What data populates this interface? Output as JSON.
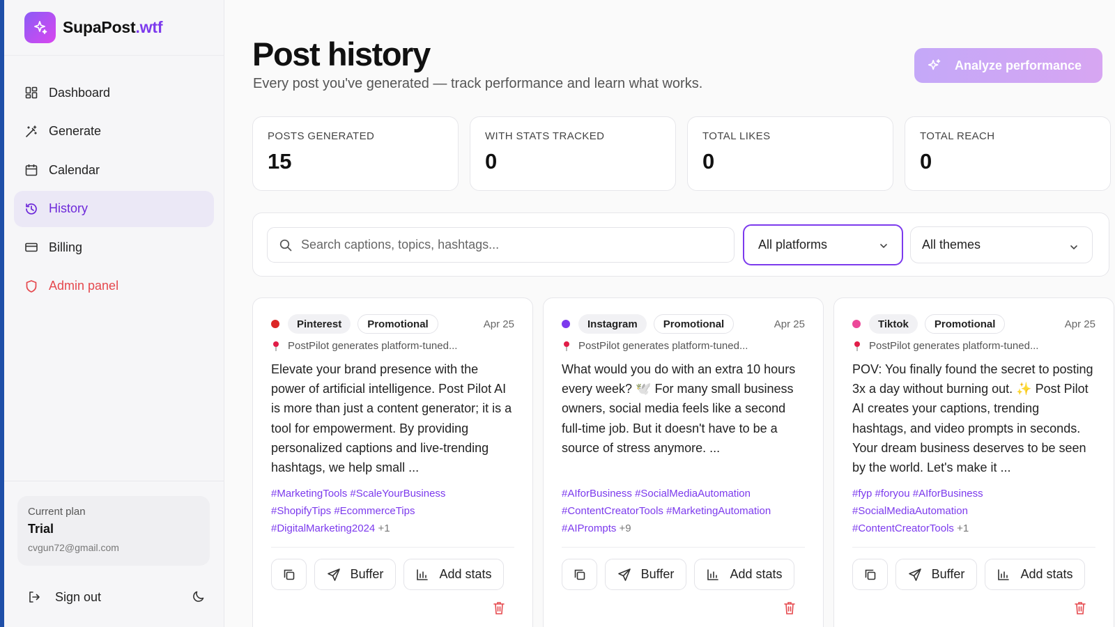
{
  "brand": {
    "name": "SupaPost",
    "tld": ".wtf"
  },
  "sidebar": {
    "items": [
      {
        "label": "Dashboard",
        "icon": "dashboard-icon"
      },
      {
        "label": "Generate",
        "icon": "wand-icon"
      },
      {
        "label": "Calendar",
        "icon": "calendar-icon"
      },
      {
        "label": "History",
        "icon": "history-icon",
        "active": true
      },
      {
        "label": "Billing",
        "icon": "credit-card-icon"
      },
      {
        "label": "Admin panel",
        "icon": "shield-icon"
      }
    ],
    "plan": {
      "label": "Current plan",
      "name": "Trial",
      "email": "cvgun72@gmail.com"
    },
    "signout": "Sign out"
  },
  "page": {
    "title": "Post history",
    "subtitle": "Every post you've generated — track performance and learn what works.",
    "analyze_label": "Analyze performance"
  },
  "stats": [
    {
      "label": "POSTS GENERATED",
      "value": "15"
    },
    {
      "label": "WITH STATS TRACKED",
      "value": "0"
    },
    {
      "label": "TOTAL LIKES",
      "value": "0"
    },
    {
      "label": "TOTAL REACH",
      "value": "0"
    }
  ],
  "filters": {
    "search_placeholder": "Search captions, topics, hashtags...",
    "platform": "All platforms",
    "theme": "All themes"
  },
  "posts": [
    {
      "platform": "Pinterest",
      "platform_color": "#dc2626",
      "theme": "Promotional",
      "date": "Apr 25",
      "topic": "PostPilot generates platform-tuned...",
      "caption": "Elevate your brand presence with the power of artificial intelligence. Post Pilot AI is more than just a content generator; it is a tool for empowerment. By providing personalized captions and live-trending hashtags, we help small ...",
      "hashtags": [
        "#MarketingTools",
        "#ScaleYourBusiness",
        "#ShopifyTips",
        "#EcommerceTips",
        "#DigitalMarketing2024"
      ],
      "more": "+1"
    },
    {
      "platform": "Instagram",
      "platform_color": "#7c3aed",
      "theme": "Promotional",
      "date": "Apr 25",
      "topic": "PostPilot generates platform-tuned...",
      "caption": "What would you do with an extra 10 hours every week? 🕊️ For many small business owners, social media feels like a second full-time job. But it doesn't have to be a source of stress anymore. ...",
      "hashtags": [
        "#AIforBusiness",
        "#SocialMediaAutomation",
        "#ContentCreatorTools",
        "#MarketingAutomation",
        "#AIPrompts"
      ],
      "more": "+9"
    },
    {
      "platform": "Tiktok",
      "platform_color": "#ec4899",
      "theme": "Promotional",
      "date": "Apr 25",
      "topic": "PostPilot generates platform-tuned...",
      "caption": "POV: You finally found the secret to posting 3x a day without burning out. ✨ Post Pilot AI creates your captions, trending hashtags, and video prompts in seconds. Your dream business deserves to be seen by the world. Let's make it ...",
      "hashtags": [
        "#fyp",
        "#foryou",
        "#AIforBusiness",
        "#SocialMediaAutomation",
        "#ContentCreatorTools"
      ],
      "more": "+1"
    }
  ],
  "card_actions": {
    "buffer": "Buffer",
    "add_stats": "Add stats"
  },
  "colors": {
    "accent": "#7c3aed",
    "danger": "#e5484d"
  }
}
